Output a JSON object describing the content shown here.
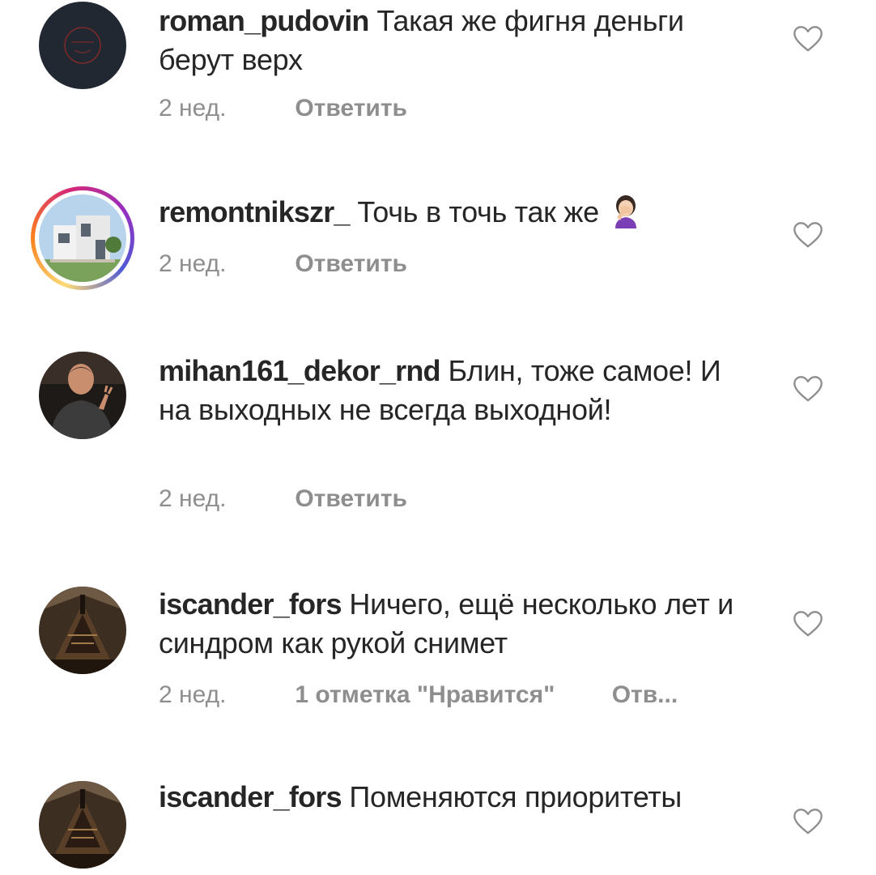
{
  "comments": [
    {
      "username": "roman_pudovin",
      "text": "Такая же фигня деньги берут верх",
      "time": "2 нед.",
      "reply": "Ответить"
    },
    {
      "username": "remontnikszr_",
      "text": "Точь в точь так же",
      "emoji": "woman-facepalming-icon",
      "time": "2 нед.",
      "reply": "Ответить"
    },
    {
      "username": "mihan161_dekor_rnd",
      "text": "Блин, тоже самое! И на выходных не всегда выходной!",
      "time": "2 нед.",
      "reply": "Ответить"
    },
    {
      "username": "iscander_fors",
      "text": "Ничего, ещё несколько лет и синдром как рукой снимет",
      "time": "2 нед.",
      "likes": "1 отметка \"Нравится\"",
      "reply": "Отв..."
    },
    {
      "username": "iscander_fors",
      "text": "Поменяются приоритеты"
    }
  ],
  "colors": {
    "text": "#262626",
    "secondary": "#8e8e8e",
    "heart_outline": "#8e8e8e"
  }
}
